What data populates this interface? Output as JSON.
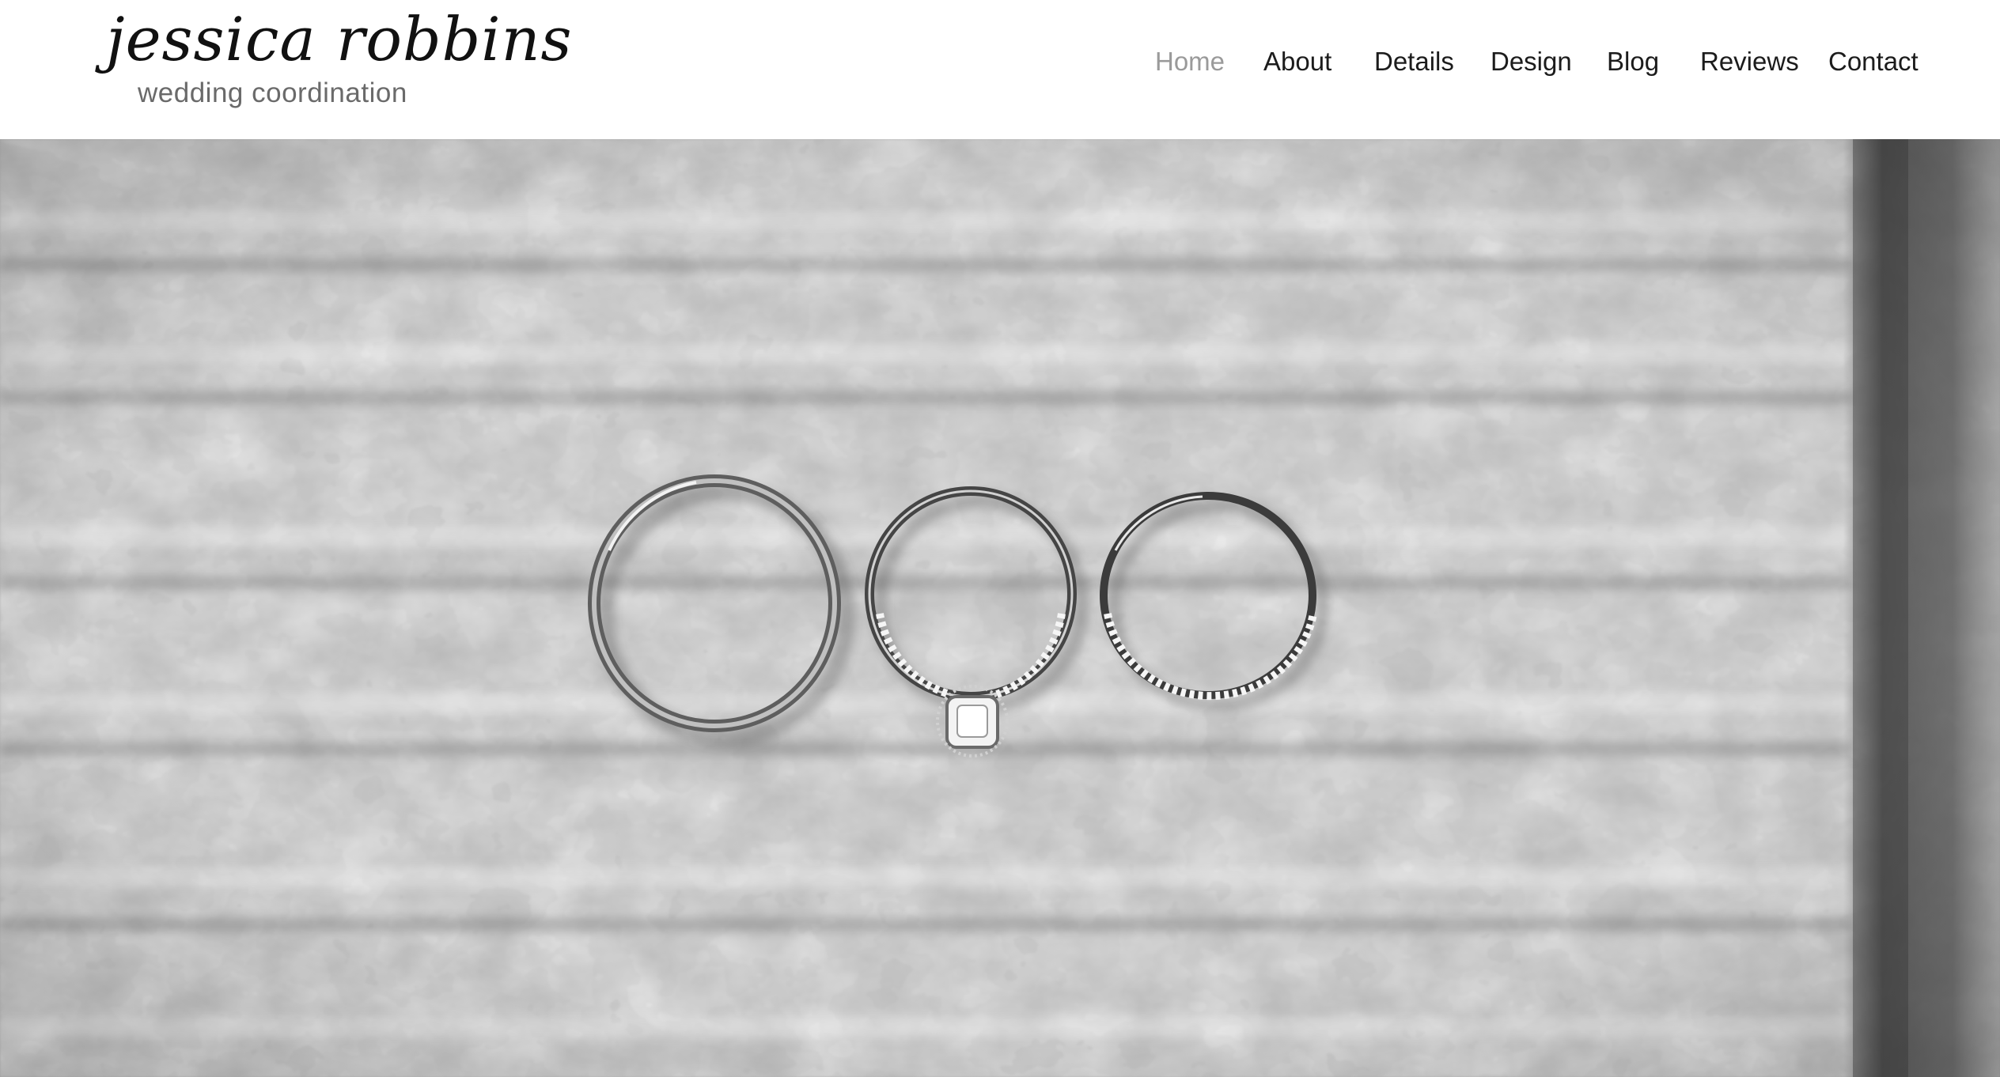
{
  "brand": {
    "name": "jessica robbins",
    "tagline": "wedding coordination"
  },
  "nav": {
    "items": [
      {
        "label": "Home",
        "active": true
      },
      {
        "label": "About",
        "active": false
      },
      {
        "label": "Details",
        "active": false
      },
      {
        "label": "Design",
        "active": false
      },
      {
        "label": "Blog",
        "active": false
      },
      {
        "label": "Reviews",
        "active": false
      },
      {
        "label": "Contact",
        "active": false
      }
    ]
  },
  "hero": {
    "image": "three-wedding-rings-on-galvanized-metal-icon",
    "style": "black-and-white"
  },
  "colors": {
    "nav_text": "#1c1c1c",
    "nav_active": "#9a9a9a",
    "logo_text": "#111111",
    "tagline_text": "#6a6a6a"
  }
}
